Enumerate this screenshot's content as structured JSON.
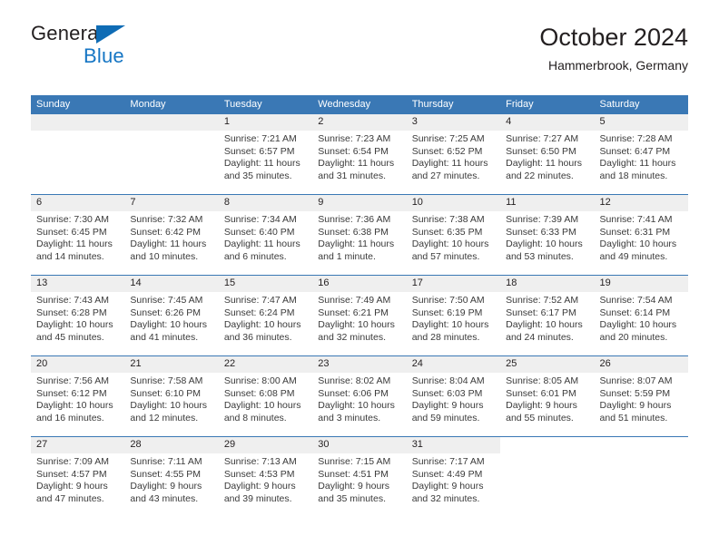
{
  "brand": {
    "name_top": "General",
    "name_bottom": "Blue",
    "accent_color": "#1676c4"
  },
  "header": {
    "title": "October 2024",
    "subtitle": "Hammerbrook, Germany"
  },
  "theme": {
    "header_blue": "#3a78b5",
    "day_band_gray": "#efefef",
    "text_color": "#231f20"
  },
  "weekdays": [
    "Sunday",
    "Monday",
    "Tuesday",
    "Wednesday",
    "Thursday",
    "Friday",
    "Saturday"
  ],
  "weeks": [
    [
      {
        "day": "",
        "sunrise": "",
        "sunset": "",
        "daylight_1": "",
        "daylight_2": "",
        "state": "empty"
      },
      {
        "day": "",
        "sunrise": "",
        "sunset": "",
        "daylight_1": "",
        "daylight_2": "",
        "state": "empty"
      },
      {
        "day": "1",
        "sunrise": "Sunrise: 7:21 AM",
        "sunset": "Sunset: 6:57 PM",
        "daylight_1": "Daylight: 11 hours",
        "daylight_2": "and 35 minutes.",
        "state": "filled"
      },
      {
        "day": "2",
        "sunrise": "Sunrise: 7:23 AM",
        "sunset": "Sunset: 6:54 PM",
        "daylight_1": "Daylight: 11 hours",
        "daylight_2": "and 31 minutes.",
        "state": "filled"
      },
      {
        "day": "3",
        "sunrise": "Sunrise: 7:25 AM",
        "sunset": "Sunset: 6:52 PM",
        "daylight_1": "Daylight: 11 hours",
        "daylight_2": "and 27 minutes.",
        "state": "filled"
      },
      {
        "day": "4",
        "sunrise": "Sunrise: 7:27 AM",
        "sunset": "Sunset: 6:50 PM",
        "daylight_1": "Daylight: 11 hours",
        "daylight_2": "and 22 minutes.",
        "state": "filled"
      },
      {
        "day": "5",
        "sunrise": "Sunrise: 7:28 AM",
        "sunset": "Sunset: 6:47 PM",
        "daylight_1": "Daylight: 11 hours",
        "daylight_2": "and 18 minutes.",
        "state": "filled"
      }
    ],
    [
      {
        "day": "6",
        "sunrise": "Sunrise: 7:30 AM",
        "sunset": "Sunset: 6:45 PM",
        "daylight_1": "Daylight: 11 hours",
        "daylight_2": "and 14 minutes.",
        "state": "filled"
      },
      {
        "day": "7",
        "sunrise": "Sunrise: 7:32 AM",
        "sunset": "Sunset: 6:42 PM",
        "daylight_1": "Daylight: 11 hours",
        "daylight_2": "and 10 minutes.",
        "state": "filled"
      },
      {
        "day": "8",
        "sunrise": "Sunrise: 7:34 AM",
        "sunset": "Sunset: 6:40 PM",
        "daylight_1": "Daylight: 11 hours",
        "daylight_2": "and 6 minutes.",
        "state": "filled"
      },
      {
        "day": "9",
        "sunrise": "Sunrise: 7:36 AM",
        "sunset": "Sunset: 6:38 PM",
        "daylight_1": "Daylight: 11 hours",
        "daylight_2": "and 1 minute.",
        "state": "filled"
      },
      {
        "day": "10",
        "sunrise": "Sunrise: 7:38 AM",
        "sunset": "Sunset: 6:35 PM",
        "daylight_1": "Daylight: 10 hours",
        "daylight_2": "and 57 minutes.",
        "state": "filled"
      },
      {
        "day": "11",
        "sunrise": "Sunrise: 7:39 AM",
        "sunset": "Sunset: 6:33 PM",
        "daylight_1": "Daylight: 10 hours",
        "daylight_2": "and 53 minutes.",
        "state": "filled"
      },
      {
        "day": "12",
        "sunrise": "Sunrise: 7:41 AM",
        "sunset": "Sunset: 6:31 PM",
        "daylight_1": "Daylight: 10 hours",
        "daylight_2": "and 49 minutes.",
        "state": "filled"
      }
    ],
    [
      {
        "day": "13",
        "sunrise": "Sunrise: 7:43 AM",
        "sunset": "Sunset: 6:28 PM",
        "daylight_1": "Daylight: 10 hours",
        "daylight_2": "and 45 minutes.",
        "state": "filled"
      },
      {
        "day": "14",
        "sunrise": "Sunrise: 7:45 AM",
        "sunset": "Sunset: 6:26 PM",
        "daylight_1": "Daylight: 10 hours",
        "daylight_2": "and 41 minutes.",
        "state": "filled"
      },
      {
        "day": "15",
        "sunrise": "Sunrise: 7:47 AM",
        "sunset": "Sunset: 6:24 PM",
        "daylight_1": "Daylight: 10 hours",
        "daylight_2": "and 36 minutes.",
        "state": "filled"
      },
      {
        "day": "16",
        "sunrise": "Sunrise: 7:49 AM",
        "sunset": "Sunset: 6:21 PM",
        "daylight_1": "Daylight: 10 hours",
        "daylight_2": "and 32 minutes.",
        "state": "filled"
      },
      {
        "day": "17",
        "sunrise": "Sunrise: 7:50 AM",
        "sunset": "Sunset: 6:19 PM",
        "daylight_1": "Daylight: 10 hours",
        "daylight_2": "and 28 minutes.",
        "state": "filled"
      },
      {
        "day": "18",
        "sunrise": "Sunrise: 7:52 AM",
        "sunset": "Sunset: 6:17 PM",
        "daylight_1": "Daylight: 10 hours",
        "daylight_2": "and 24 minutes.",
        "state": "filled"
      },
      {
        "day": "19",
        "sunrise": "Sunrise: 7:54 AM",
        "sunset": "Sunset: 6:14 PM",
        "daylight_1": "Daylight: 10 hours",
        "daylight_2": "and 20 minutes.",
        "state": "filled"
      }
    ],
    [
      {
        "day": "20",
        "sunrise": "Sunrise: 7:56 AM",
        "sunset": "Sunset: 6:12 PM",
        "daylight_1": "Daylight: 10 hours",
        "daylight_2": "and 16 minutes.",
        "state": "filled"
      },
      {
        "day": "21",
        "sunrise": "Sunrise: 7:58 AM",
        "sunset": "Sunset: 6:10 PM",
        "daylight_1": "Daylight: 10 hours",
        "daylight_2": "and 12 minutes.",
        "state": "filled"
      },
      {
        "day": "22",
        "sunrise": "Sunrise: 8:00 AM",
        "sunset": "Sunset: 6:08 PM",
        "daylight_1": "Daylight: 10 hours",
        "daylight_2": "and 8 minutes.",
        "state": "filled"
      },
      {
        "day": "23",
        "sunrise": "Sunrise: 8:02 AM",
        "sunset": "Sunset: 6:06 PM",
        "daylight_1": "Daylight: 10 hours",
        "daylight_2": "and 3 minutes.",
        "state": "filled"
      },
      {
        "day": "24",
        "sunrise": "Sunrise: 8:04 AM",
        "sunset": "Sunset: 6:03 PM",
        "daylight_1": "Daylight: 9 hours",
        "daylight_2": "and 59 minutes.",
        "state": "filled"
      },
      {
        "day": "25",
        "sunrise": "Sunrise: 8:05 AM",
        "sunset": "Sunset: 6:01 PM",
        "daylight_1": "Daylight: 9 hours",
        "daylight_2": "and 55 minutes.",
        "state": "filled"
      },
      {
        "day": "26",
        "sunrise": "Sunrise: 8:07 AM",
        "sunset": "Sunset: 5:59 PM",
        "daylight_1": "Daylight: 9 hours",
        "daylight_2": "and 51 minutes.",
        "state": "filled"
      }
    ],
    [
      {
        "day": "27",
        "sunrise": "Sunrise: 7:09 AM",
        "sunset": "Sunset: 4:57 PM",
        "daylight_1": "Daylight: 9 hours",
        "daylight_2": "and 47 minutes.",
        "state": "filled"
      },
      {
        "day": "28",
        "sunrise": "Sunrise: 7:11 AM",
        "sunset": "Sunset: 4:55 PM",
        "daylight_1": "Daylight: 9 hours",
        "daylight_2": "and 43 minutes.",
        "state": "filled"
      },
      {
        "day": "29",
        "sunrise": "Sunrise: 7:13 AM",
        "sunset": "Sunset: 4:53 PM",
        "daylight_1": "Daylight: 9 hours",
        "daylight_2": "and 39 minutes.",
        "state": "filled"
      },
      {
        "day": "30",
        "sunrise": "Sunrise: 7:15 AM",
        "sunset": "Sunset: 4:51 PM",
        "daylight_1": "Daylight: 9 hours",
        "daylight_2": "and 35 minutes.",
        "state": "filled"
      },
      {
        "day": "31",
        "sunrise": "Sunrise: 7:17 AM",
        "sunset": "Sunset: 4:49 PM",
        "daylight_1": "Daylight: 9 hours",
        "daylight_2": "and 32 minutes.",
        "state": "filled"
      },
      {
        "day": "",
        "sunrise": "",
        "sunset": "",
        "daylight_1": "",
        "daylight_2": "",
        "state": "blank"
      },
      {
        "day": "",
        "sunrise": "",
        "sunset": "",
        "daylight_1": "",
        "daylight_2": "",
        "state": "blank"
      }
    ]
  ]
}
